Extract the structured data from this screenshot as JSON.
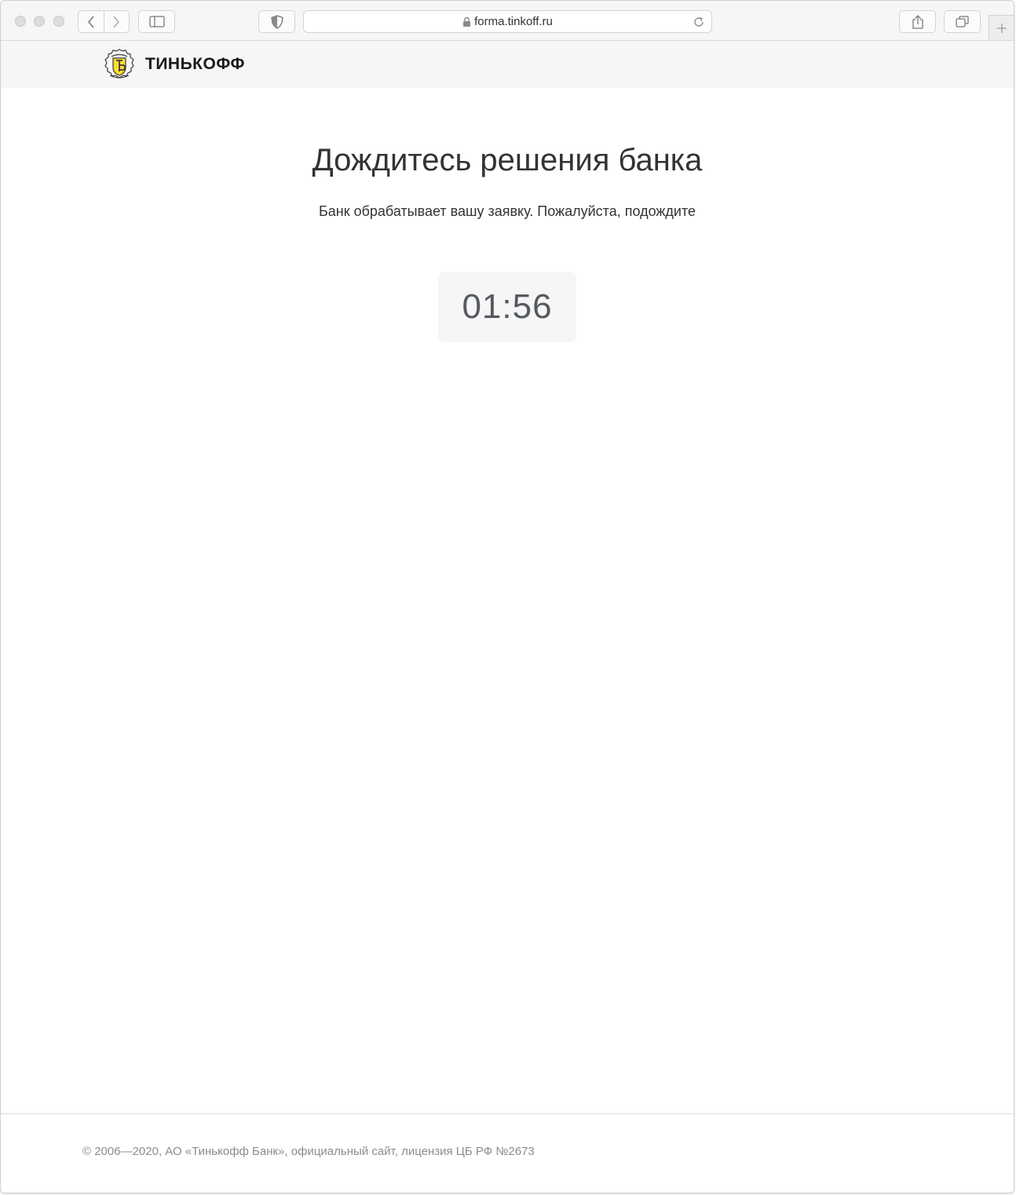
{
  "browser": {
    "url": "forma.tinkoff.ru",
    "icons": {
      "back": "chevron-left-icon",
      "forward": "chevron-right-icon",
      "sidebar": "sidebar-icon",
      "privacy": "shield-icon",
      "lock": "lock-icon",
      "reload": "reload-icon",
      "share": "share-icon",
      "tabs": "tabs-overview-icon",
      "new_tab": "plus-icon"
    }
  },
  "header": {
    "brand": "ТИНЬКОФФ",
    "brand_color": "#ffdd2d"
  },
  "main": {
    "title": "Дождитесь решения банка",
    "subtitle": "Банк обрабатывает вашу заявку. Пожалуйста, подождите",
    "timer": "01:56"
  },
  "footer": {
    "copyright": "© 2006—2020, АО «Тинькофф Банк», официальный сайт, лицензия ЦБ РФ №2673"
  }
}
